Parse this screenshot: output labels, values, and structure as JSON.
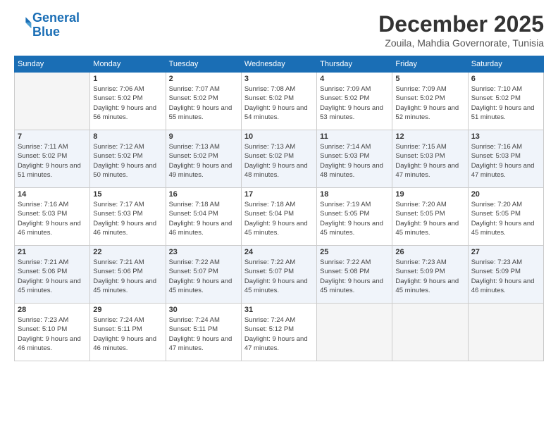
{
  "logo": {
    "line1": "General",
    "line2": "Blue"
  },
  "title": "December 2025",
  "location": "Zouila, Mahdia Governorate, Tunisia",
  "days_of_week": [
    "Sunday",
    "Monday",
    "Tuesday",
    "Wednesday",
    "Thursday",
    "Friday",
    "Saturday"
  ],
  "weeks": [
    [
      {
        "day": "",
        "empty": true
      },
      {
        "day": "1",
        "sunrise": "7:06 AM",
        "sunset": "5:02 PM",
        "daylight": "9 hours and 56 minutes."
      },
      {
        "day": "2",
        "sunrise": "7:07 AM",
        "sunset": "5:02 PM",
        "daylight": "9 hours and 55 minutes."
      },
      {
        "day": "3",
        "sunrise": "7:08 AM",
        "sunset": "5:02 PM",
        "daylight": "9 hours and 54 minutes."
      },
      {
        "day": "4",
        "sunrise": "7:09 AM",
        "sunset": "5:02 PM",
        "daylight": "9 hours and 53 minutes."
      },
      {
        "day": "5",
        "sunrise": "7:09 AM",
        "sunset": "5:02 PM",
        "daylight": "9 hours and 52 minutes."
      },
      {
        "day": "6",
        "sunrise": "7:10 AM",
        "sunset": "5:02 PM",
        "daylight": "9 hours and 51 minutes."
      }
    ],
    [
      {
        "day": "7",
        "sunrise": "7:11 AM",
        "sunset": "5:02 PM",
        "daylight": "9 hours and 51 minutes."
      },
      {
        "day": "8",
        "sunrise": "7:12 AM",
        "sunset": "5:02 PM",
        "daylight": "9 hours and 50 minutes."
      },
      {
        "day": "9",
        "sunrise": "7:13 AM",
        "sunset": "5:02 PM",
        "daylight": "9 hours and 49 minutes."
      },
      {
        "day": "10",
        "sunrise": "7:13 AM",
        "sunset": "5:02 PM",
        "daylight": "9 hours and 48 minutes."
      },
      {
        "day": "11",
        "sunrise": "7:14 AM",
        "sunset": "5:03 PM",
        "daylight": "9 hours and 48 minutes."
      },
      {
        "day": "12",
        "sunrise": "7:15 AM",
        "sunset": "5:03 PM",
        "daylight": "9 hours and 47 minutes."
      },
      {
        "day": "13",
        "sunrise": "7:16 AM",
        "sunset": "5:03 PM",
        "daylight": "9 hours and 47 minutes."
      }
    ],
    [
      {
        "day": "14",
        "sunrise": "7:16 AM",
        "sunset": "5:03 PM",
        "daylight": "9 hours and 46 minutes."
      },
      {
        "day": "15",
        "sunrise": "7:17 AM",
        "sunset": "5:03 PM",
        "daylight": "9 hours and 46 minutes."
      },
      {
        "day": "16",
        "sunrise": "7:18 AM",
        "sunset": "5:04 PM",
        "daylight": "9 hours and 46 minutes."
      },
      {
        "day": "17",
        "sunrise": "7:18 AM",
        "sunset": "5:04 PM",
        "daylight": "9 hours and 45 minutes."
      },
      {
        "day": "18",
        "sunrise": "7:19 AM",
        "sunset": "5:05 PM",
        "daylight": "9 hours and 45 minutes."
      },
      {
        "day": "19",
        "sunrise": "7:20 AM",
        "sunset": "5:05 PM",
        "daylight": "9 hours and 45 minutes."
      },
      {
        "day": "20",
        "sunrise": "7:20 AM",
        "sunset": "5:05 PM",
        "daylight": "9 hours and 45 minutes."
      }
    ],
    [
      {
        "day": "21",
        "sunrise": "7:21 AM",
        "sunset": "5:06 PM",
        "daylight": "9 hours and 45 minutes."
      },
      {
        "day": "22",
        "sunrise": "7:21 AM",
        "sunset": "5:06 PM",
        "daylight": "9 hours and 45 minutes."
      },
      {
        "day": "23",
        "sunrise": "7:22 AM",
        "sunset": "5:07 PM",
        "daylight": "9 hours and 45 minutes."
      },
      {
        "day": "24",
        "sunrise": "7:22 AM",
        "sunset": "5:07 PM",
        "daylight": "9 hours and 45 minutes."
      },
      {
        "day": "25",
        "sunrise": "7:22 AM",
        "sunset": "5:08 PM",
        "daylight": "9 hours and 45 minutes."
      },
      {
        "day": "26",
        "sunrise": "7:23 AM",
        "sunset": "5:09 PM",
        "daylight": "9 hours and 45 minutes."
      },
      {
        "day": "27",
        "sunrise": "7:23 AM",
        "sunset": "5:09 PM",
        "daylight": "9 hours and 46 minutes."
      }
    ],
    [
      {
        "day": "28",
        "sunrise": "7:23 AM",
        "sunset": "5:10 PM",
        "daylight": "9 hours and 46 minutes."
      },
      {
        "day": "29",
        "sunrise": "7:24 AM",
        "sunset": "5:11 PM",
        "daylight": "9 hours and 46 minutes."
      },
      {
        "day": "30",
        "sunrise": "7:24 AM",
        "sunset": "5:11 PM",
        "daylight": "9 hours and 47 minutes."
      },
      {
        "day": "31",
        "sunrise": "7:24 AM",
        "sunset": "5:12 PM",
        "daylight": "9 hours and 47 minutes."
      },
      {
        "day": "",
        "empty": true
      },
      {
        "day": "",
        "empty": true
      },
      {
        "day": "",
        "empty": true
      }
    ]
  ],
  "labels": {
    "sunrise_prefix": "Sunrise: ",
    "sunset_prefix": "Sunset: ",
    "daylight_prefix": "Daylight: "
  }
}
